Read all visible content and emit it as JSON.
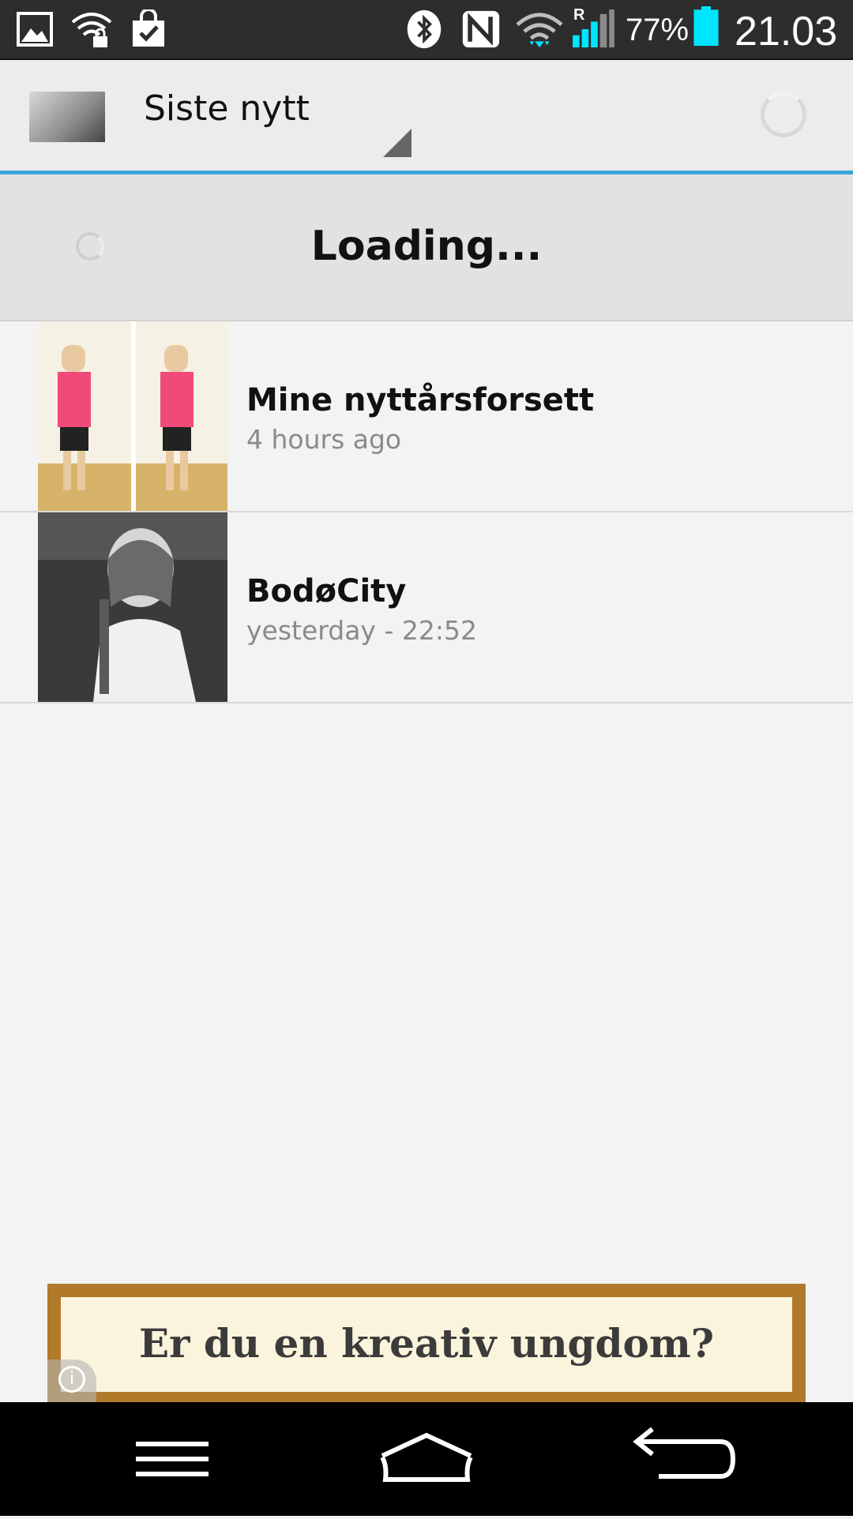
{
  "status_bar": {
    "battery": "77%",
    "time": "21.03",
    "signal_roaming": "R",
    "icons": [
      "gallery-icon",
      "wifi-lock-icon",
      "shopping-bag-check-icon",
      "bluetooth-icon",
      "nfc-icon",
      "wifi-icon",
      "signal-icon",
      "battery-icon"
    ],
    "battery_color": "#00e5ff"
  },
  "action_bar": {
    "title": "Siste nytt",
    "accent_color": "#3aa6d8"
  },
  "loading": {
    "text": "Loading..."
  },
  "list": {
    "items": [
      {
        "title": "Mine nyttårsforsett",
        "time": "4 hours ago"
      },
      {
        "title": "BodøCity",
        "time": "yesterday - 22:52"
      }
    ]
  },
  "ad": {
    "text": "Er du en kreativ ungdom?"
  },
  "nav_bar": {
    "buttons": [
      "menu-icon",
      "home-icon",
      "back-icon"
    ]
  }
}
